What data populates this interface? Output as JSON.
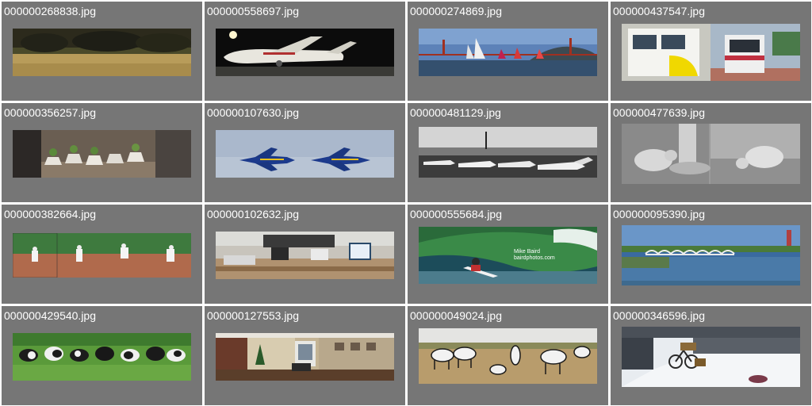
{
  "gallery": {
    "tiles": [
      {
        "filename": "000000268838.jpg",
        "scene": "field-trees"
      },
      {
        "filename": "000000558697.jpg",
        "scene": "airplane-night"
      },
      {
        "filename": "000000274869.jpg",
        "scene": "sailboats-bridge"
      },
      {
        "filename": "000000437547.jpg",
        "scene": "trains-station"
      },
      {
        "filename": "000000356257.jpg",
        "scene": "shoe-planters"
      },
      {
        "filename": "000000107630.jpg",
        "scene": "jets-formation"
      },
      {
        "filename": "000000481129.jpg",
        "scene": "parked-planes"
      },
      {
        "filename": "000000477639.jpg",
        "scene": "sheep-bw"
      },
      {
        "filename": "000000382664.jpg",
        "scene": "baseball-pitcher"
      },
      {
        "filename": "000000102632.jpg",
        "scene": "office-desks"
      },
      {
        "filename": "000000555684.jpg",
        "scene": "surfer-wave",
        "watermark": [
          "Mike Baird",
          "bairdphotos.com"
        ]
      },
      {
        "filename": "000000095390.jpg",
        "scene": "river-bridge"
      },
      {
        "filename": "000000429540.jpg",
        "scene": "cows-field"
      },
      {
        "filename": "000000127553.jpg",
        "scene": "room-panorama"
      },
      {
        "filename": "000000049024.jpg",
        "scene": "zebras-savanna"
      },
      {
        "filename": "000000346596.jpg",
        "scene": "bicycle-snow"
      }
    ],
    "colors": {
      "tile_background": "#767676",
      "filename_text": "#ffffff",
      "gutter": "#ffffff"
    }
  }
}
